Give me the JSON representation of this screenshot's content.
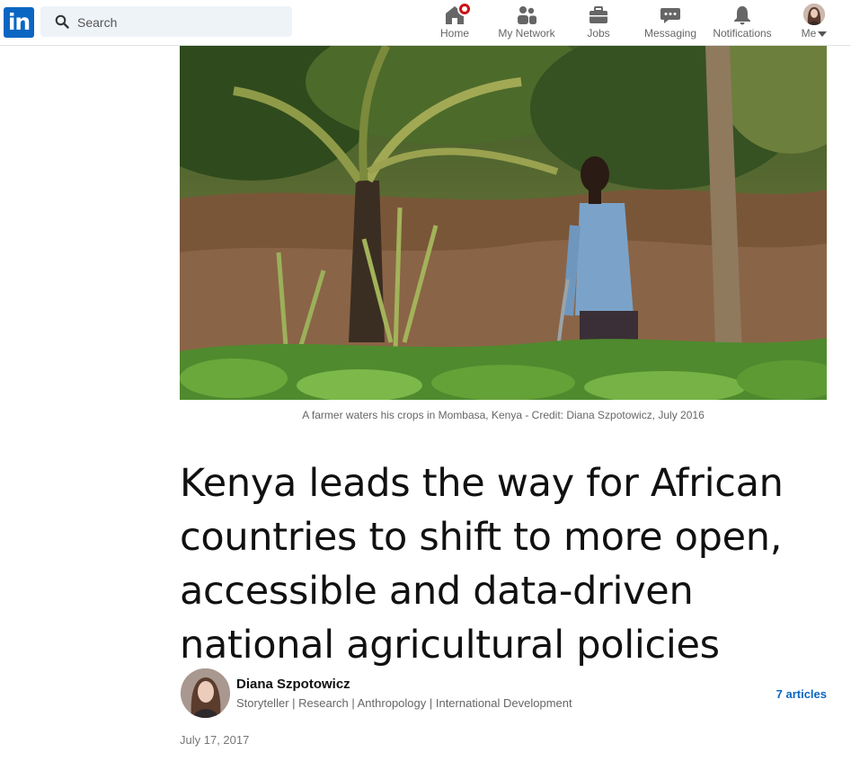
{
  "nav": {
    "logo_text": "in",
    "search_placeholder": "Search",
    "items": [
      {
        "label": "Home",
        "icon": "home-icon",
        "has_notification": true
      },
      {
        "label": "My Network",
        "icon": "people-icon"
      },
      {
        "label": "Jobs",
        "icon": "briefcase-icon"
      },
      {
        "label": "Messaging",
        "icon": "chat-icon"
      },
      {
        "label": "Notifications",
        "icon": "bell-icon"
      },
      {
        "label": "Me",
        "icon": "avatar"
      }
    ],
    "badge_color": "#cc1016",
    "brand_color": "#0a66c2"
  },
  "article": {
    "caption": "A farmer waters his crops in Mombasa, Kenya - Credit: Diana Szpotowicz, July 2016",
    "title": "Kenya leads the way for African countries to shift to more open, accessible and data-driven national agricultural policies",
    "author": {
      "name": "Diana Szpotowicz",
      "headline": "Storyteller | Research | Anthropology | International Development",
      "articles_link": "7 articles"
    },
    "date": "July 17, 2017"
  }
}
